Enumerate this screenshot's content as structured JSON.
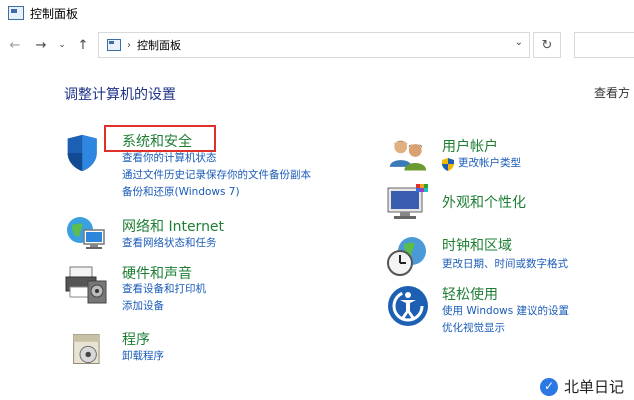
{
  "window": {
    "title": "控制面板"
  },
  "nav": {
    "back_icon": "←",
    "forward_icon": "→",
    "recent_icon": "⌄",
    "up_icon": "↑",
    "refresh_icon": "↻"
  },
  "address": {
    "separator": "›",
    "crumb": "控制面板",
    "dropdown_icon": "⌄"
  },
  "main": {
    "title": "调整计算机的设置",
    "view_by": "查看方"
  },
  "left_categories": [
    {
      "heading": "系统和安全",
      "links": [
        "查看你的计算机状态",
        "通过文件历史记录保存你的文件备份副本",
        "备份和还原(Windows 7)"
      ]
    },
    {
      "heading": "网络和 Internet",
      "links": [
        "查看网络状态和任务"
      ]
    },
    {
      "heading": "硬件和声音",
      "links": [
        "查看设备和打印机",
        "添加设备"
      ]
    },
    {
      "heading": "程序",
      "links": [
        "卸载程序"
      ]
    }
  ],
  "right_categories": [
    {
      "heading": "用户帐户",
      "links": [
        "更改帐户类型"
      ]
    },
    {
      "heading": "外观和个性化",
      "links": []
    },
    {
      "heading": "时钟和区域",
      "links": [
        "更改日期、时间或数字格式"
      ]
    },
    {
      "heading": "轻松使用",
      "links": [
        "使用 Windows 建议的设置",
        "优化视觉显示"
      ]
    }
  ],
  "watermark": {
    "text": "北单日记"
  },
  "colors": {
    "heading": "#1e7e34",
    "link": "#1a5bb8",
    "title": "#1e3287",
    "highlight": "#e0302a"
  }
}
